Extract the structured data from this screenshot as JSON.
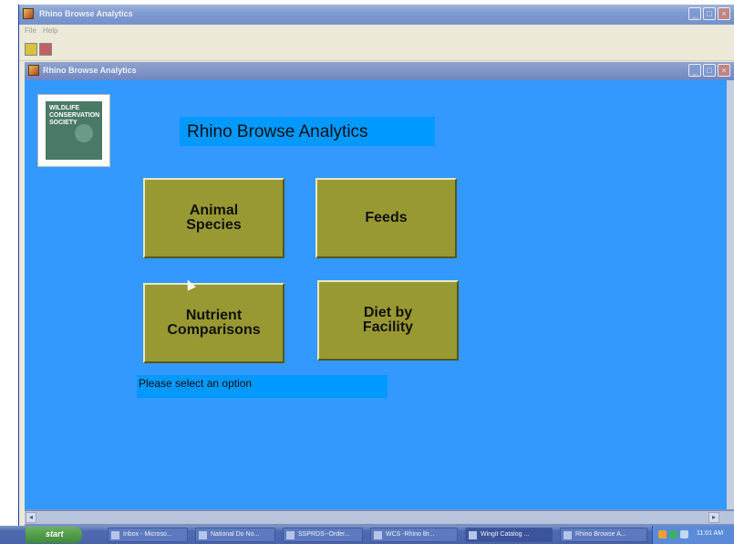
{
  "outer_window": {
    "title": "Rhino Browse Analytics",
    "menu": [
      "File",
      "Help"
    ]
  },
  "inner_window": {
    "title": "Rhino Browse Analytics"
  },
  "logo": {
    "text": "WILDLIFE\nCONSERVATION\nSOCIETY"
  },
  "form": {
    "title": "Rhino Browse Analytics",
    "buttons": {
      "animal_species": "Animal\nSpecies",
      "feeds": "Feeds",
      "nutrient_comparisons": "Nutrient\nComparisons",
      "diet_by_facility": "Diet by\nFacility"
    },
    "status": "Please select an option"
  },
  "taskbar": {
    "start": "start",
    "items": [
      "Inbox - Microso...",
      "National Do No...",
      "SSPRDS--Order...",
      "WCS -Rhino Br...",
      "Wingit Catalog ...",
      "Rhino Browse A..."
    ],
    "clock": "11:01 AM"
  },
  "colors": {
    "form_background": "#3399ff",
    "label_background": "#0099ff",
    "button_face": "#999933"
  }
}
